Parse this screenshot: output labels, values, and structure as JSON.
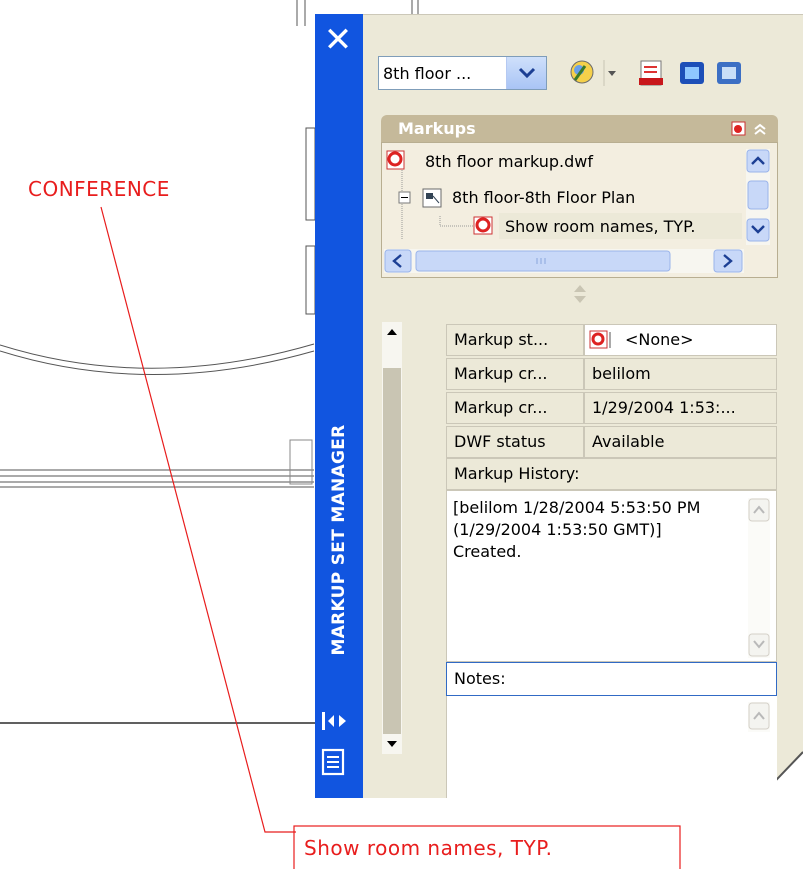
{
  "drawing": {
    "label_conference": "CONFERENCE",
    "label_show_room": "Show room names, TYP."
  },
  "palette": {
    "title": "MARKUP SET MANAGER",
    "close_glyph": "✕",
    "icons": [
      "close-icon",
      "autohide-icon",
      "properties-icon"
    ]
  },
  "toolbar": {
    "sheet_dropdown": "8th floor ...",
    "icons": [
      "republish-icon",
      "dropdown-arrow-icon",
      "markup-restore-icon",
      "view-redline-icon",
      "view-dwf-icon"
    ]
  },
  "markups": {
    "header": "Markups",
    "tree": [
      {
        "level": 0,
        "label": "8th floor markup.dwf",
        "icon": "markup-set-icon"
      },
      {
        "level": 1,
        "label": "8th floor-8th Floor Plan",
        "icon": "sheet-icon"
      },
      {
        "level": 2,
        "label": "Show room names, TYP.",
        "icon": "markup-icon",
        "selected": true
      }
    ]
  },
  "details": {
    "rows": [
      {
        "label": "Markup st...",
        "value": "<None>"
      },
      {
        "label": "Markup cr...",
        "value": "belilom"
      },
      {
        "label": "Markup cr...",
        "value": "1/29/2004 1:53:..."
      },
      {
        "label": "DWF status",
        "value": "Available"
      }
    ],
    "history_label": "Markup History:",
    "history_text": "[belilom 1/28/2004 5:53:50 PM (1/29/2004 1:53:50 GMT)]\nCreated.",
    "notes_label": "Notes:",
    "notes_value": ""
  },
  "colors": {
    "strip_blue": "#1155e0",
    "panel_bg": "#ece9d8",
    "markup_red": "#e81d1d",
    "header_tan": "#c5b99a"
  }
}
